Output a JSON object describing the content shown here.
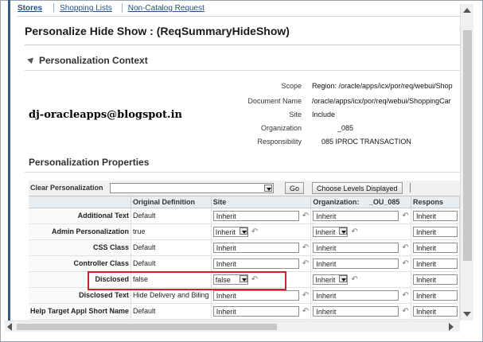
{
  "tabs": {
    "stores": "Stores",
    "shopping_lists": "Shopping Lists",
    "non_catalog": "Non-Catalog Request"
  },
  "page": {
    "title": "Personalize Hide Show : (ReqSummaryHideShow)"
  },
  "context": {
    "heading": "Personalization Context",
    "scope_label": "Scope",
    "scope_value": "Region: /oracle/apps/icx/por/req/webui/Shop",
    "document_label": "Document Name",
    "document_value": "/oracle/apps/icx/por/req/webui/ShoppingCar",
    "site_label": "Site",
    "site_value": "Include",
    "org_label": "Organization",
    "org_value": "_085",
    "resp_label": "Responsibility",
    "resp_value": "085 IPROC TRANSACTION"
  },
  "watermark": "dj-oracleapps@blogspot.in",
  "properties": {
    "heading": "Personalization Properties",
    "clear_label": "Clear Personalization",
    "clear_value": "",
    "go_label": "Go",
    "levels_label": "Choose Levels Displayed",
    "columns": {
      "name": "",
      "orig": "Original Definition",
      "site": "Site",
      "org": "Organization:",
      "org_code": "_OU_085",
      "resp": "Respons"
    },
    "rows": [
      {
        "name": "Additional Text",
        "orig": "Default",
        "site": "Inherit",
        "site_type": "text",
        "org": "Inherit",
        "org_type": "text",
        "resp": "Inherit"
      },
      {
        "name": "Admin Personalization",
        "orig": "true",
        "site": "Inherit",
        "site_type": "select",
        "org": "Inherit",
        "org_type": "select",
        "resp": "Inherit"
      },
      {
        "name": "CSS Class",
        "orig": "Default",
        "site": "Inherit",
        "site_type": "text",
        "org": "Inherit",
        "org_type": "text",
        "resp": "Inherit"
      },
      {
        "name": "Controller Class",
        "orig": "Default",
        "site": "Inherit",
        "site_type": "text",
        "org": "Inherit",
        "org_type": "text",
        "resp": "Inherit"
      },
      {
        "name": "Disclosed",
        "orig": "false",
        "site": "false",
        "site_type": "select",
        "org": "Inherit",
        "org_type": "select",
        "resp": "Inherit"
      },
      {
        "name": "Disclosed Text",
        "orig": "Hide Delivery and Biling",
        "site": "Inherit",
        "site_type": "text",
        "org": "Inherit",
        "org_type": "text",
        "resp": "Inherit"
      },
      {
        "name": "Help Target Appl Short Name",
        "orig": "Default",
        "site": "Inherit",
        "site_type": "text",
        "org": "Inherit",
        "org_type": "text",
        "resp": "Inherit"
      }
    ]
  },
  "colors": {
    "highlight": "#d0202a",
    "link": "#1f4f8a",
    "accent_bar": "#3b5a7c"
  },
  "icons": {
    "revert": "revert-icon",
    "dropdown": "chevron-down-icon"
  }
}
